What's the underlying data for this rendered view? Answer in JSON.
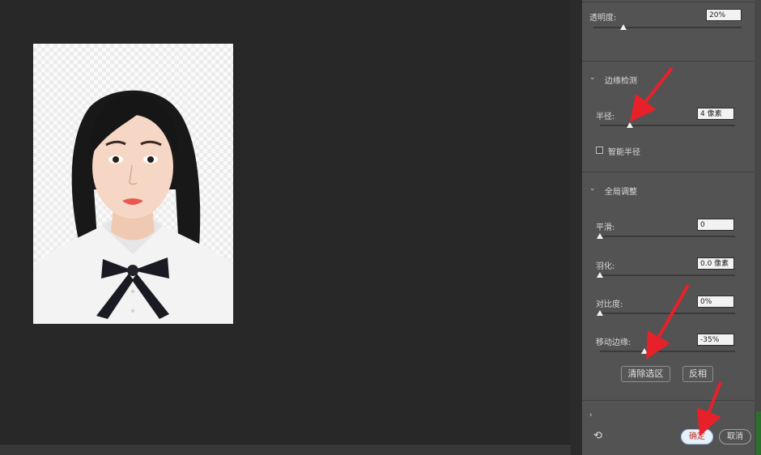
{
  "panel": {
    "opacity": {
      "label": "透明度:",
      "value": "20%",
      "level": 0.2
    },
    "edge_detection": {
      "title": "边缘检测",
      "radius": {
        "label": "半径:",
        "value": "4 像素",
        "level": 0.22
      },
      "smart_radius": {
        "label": "智能半径",
        "checked": false
      }
    },
    "global_refine": {
      "title": "全局调整",
      "smooth": {
        "label": "平滑:",
        "value": "0",
        "level": 0.0
      },
      "feather": {
        "label": "羽化:",
        "value": "0.0 像素",
        "level": 0.0
      },
      "contrast": {
        "label": "对比度:",
        "value": "0%",
        "level": 0.0
      },
      "shift_edge": {
        "label": "移动边缘:",
        "value": "-35%",
        "level": 0.33
      },
      "clear_selection": "清除选区",
      "invert": "反相"
    },
    "footer": {
      "ok": "确定",
      "cancel": "取消",
      "reset_icon": "reset-icon"
    }
  },
  "colors": {
    "workspace": "#282828",
    "panel": "#535353",
    "annotation_arrow": "#e8202a",
    "ok_button_text": "#c0392b"
  }
}
